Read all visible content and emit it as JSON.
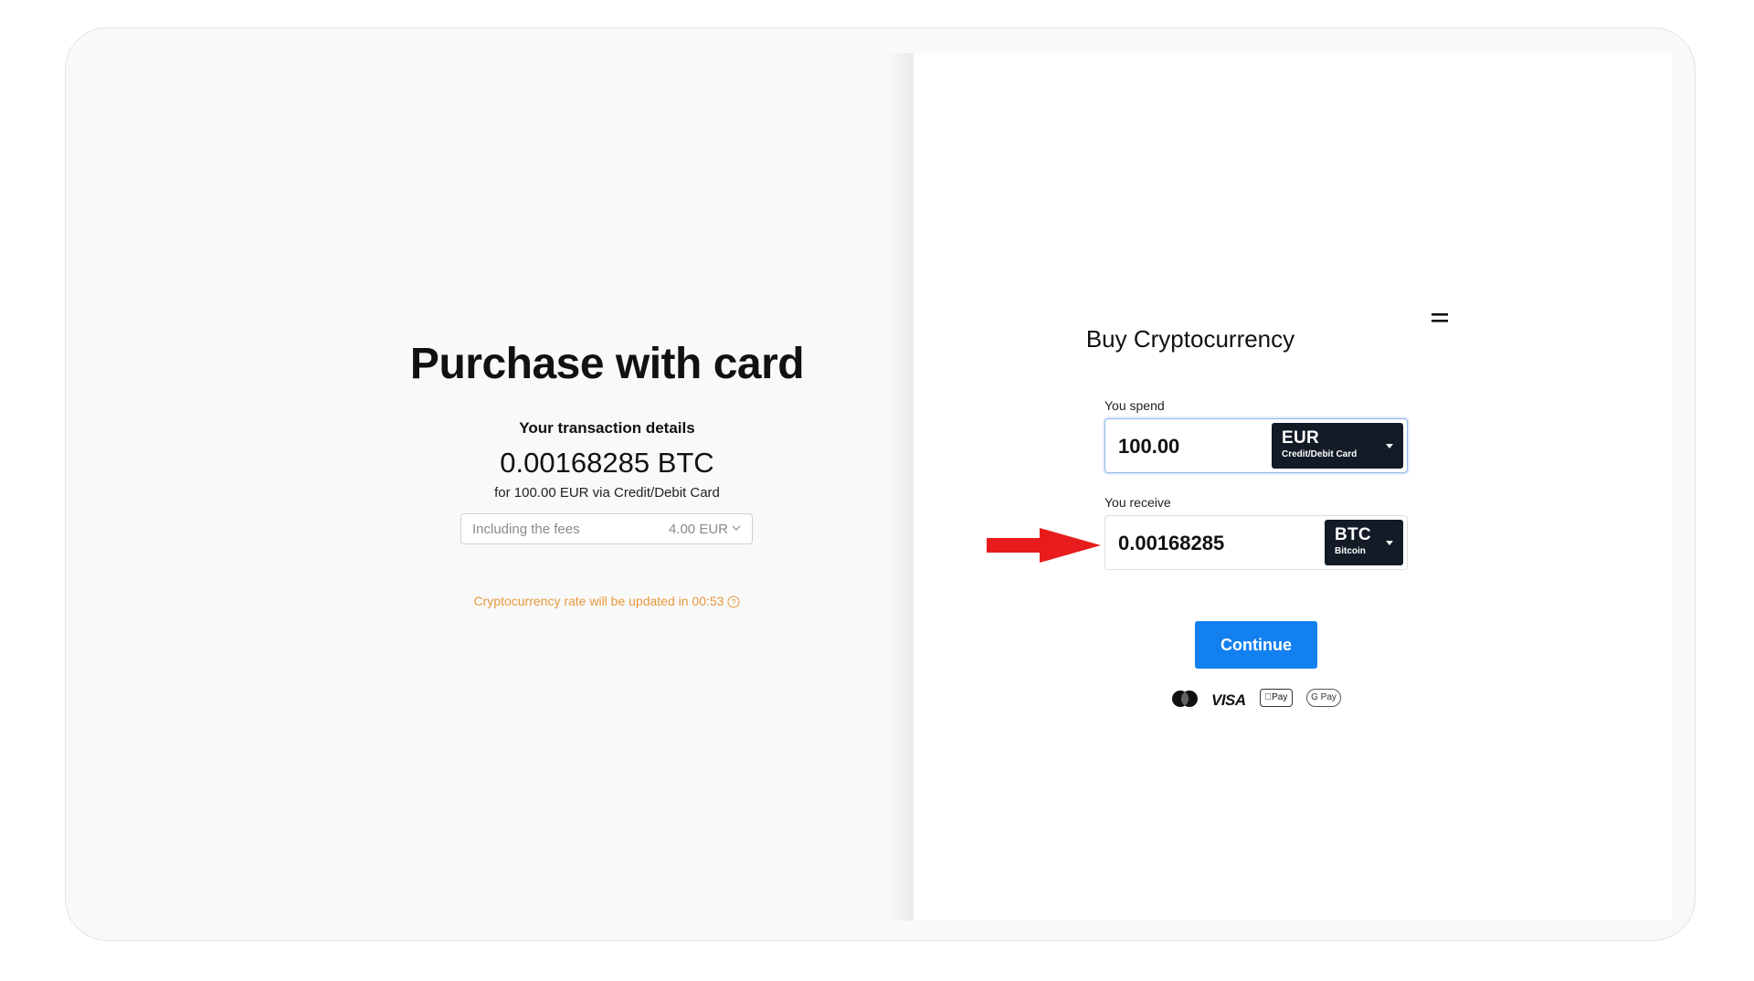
{
  "left_panel": {
    "title": "Purchase with card",
    "details_label": "Your transaction details",
    "crypto_amount": "0.00168285 BTC",
    "for_line": "for 100.00 EUR via Credit/Debit Card",
    "fees_label": "Including the fees",
    "fees_value": "4.00 EUR",
    "rate_notice": "Cryptocurrency rate will be updated in 00:53"
  },
  "widget": {
    "title": "Buy Cryptocurrency",
    "spend": {
      "label": "You spend",
      "amount": "100.00",
      "currency_code": "EUR",
      "currency_sub": "Credit/Debit Card"
    },
    "receive": {
      "label": "You receive",
      "amount": "0.00168285",
      "currency_code": "BTC",
      "currency_sub": "Bitcoin"
    },
    "continue_label": "Continue",
    "payment_methods": {
      "mastercard": "mastercard-icon",
      "visa": "VISA",
      "apple_pay": "Pay",
      "google_pay": "G Pay"
    }
  },
  "colors": {
    "accent": "#1380f0",
    "dark_button": "#121b26",
    "warning_text": "#e8983b",
    "annotation_arrow": "#e81c1c"
  },
  "icons": [
    "menu-icon",
    "chevron-down-icon",
    "help-icon",
    "caret-down-icon",
    "arrow-right-icon"
  ]
}
